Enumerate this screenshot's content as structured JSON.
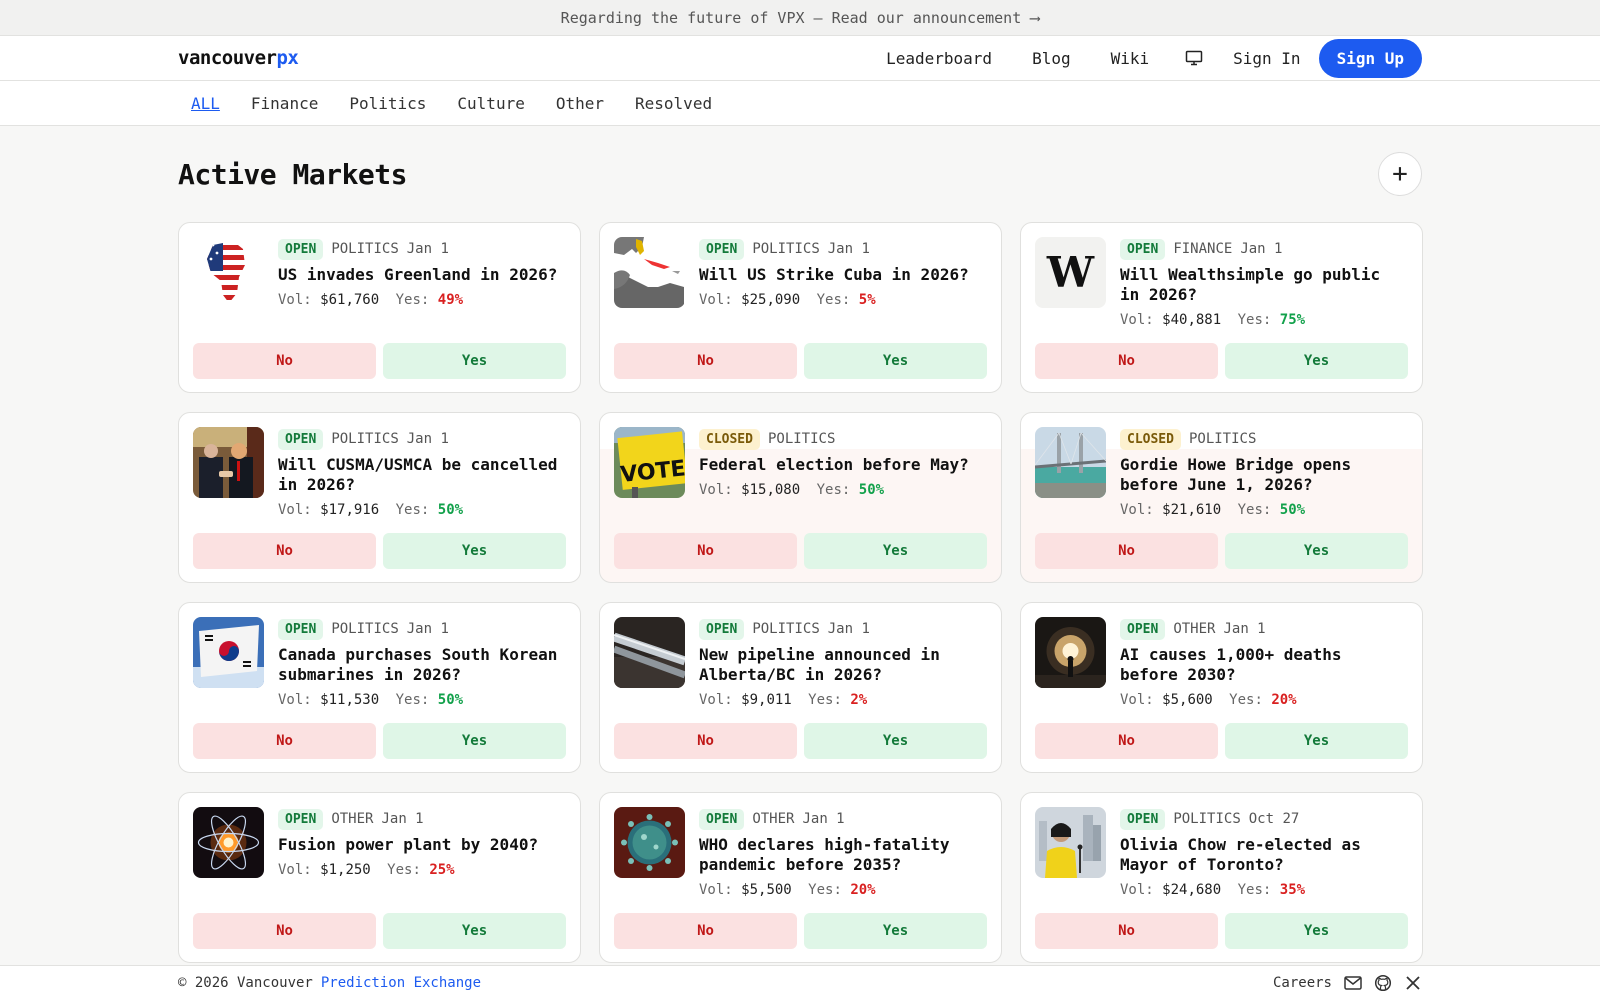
{
  "announcement": "Regarding the future of VPX — Read our announcement ⟶",
  "brand": {
    "name_part1": "vancouver",
    "name_part2": "px",
    "accent": "#1d5bf0"
  },
  "nav": {
    "leaderboard": "Leaderboard",
    "blog": "Blog",
    "wiki": "Wiki",
    "sign_in": "Sign In",
    "sign_up": "Sign Up",
    "display_icon": "monitor-icon"
  },
  "categories": [
    "ALL",
    "Finance",
    "Politics",
    "Culture",
    "Other",
    "Resolved"
  ],
  "active_category": "ALL",
  "page_title": "Active Markets",
  "add_button_glyph": "+",
  "vol_label": "Vol:",
  "yes_label": "Yes:",
  "button_no": "No",
  "button_yes": "Yes",
  "markets": [
    {
      "status": "OPEN",
      "category": "POLITICS",
      "date": "Jan 1",
      "question": "US invades Greenland in 2026?",
      "volume": "$61,760",
      "yes_pct": "49%",
      "pct_color": "red",
      "thumb": "greenland-flag-map"
    },
    {
      "status": "OPEN",
      "category": "POLITICS",
      "date": "Jan 1",
      "question": "Will US Strike Cuba in 2026?",
      "volume": "$25,090",
      "yes_pct": "5%",
      "pct_color": "red",
      "thumb": "cuba-map"
    },
    {
      "status": "OPEN",
      "category": "FINANCE",
      "date": "Jan 1",
      "question": "Will Wealthsimple go public in 2026?",
      "volume": "$40,881",
      "yes_pct": "75%",
      "pct_color": "green",
      "thumb": "wealthsimple-logo"
    },
    {
      "status": "OPEN",
      "category": "POLITICS",
      "date": "Jan 1",
      "question": "Will CUSMA/USMCA be cancelled in 2026?",
      "volume": "$17,916",
      "yes_pct": "50%",
      "pct_color": "green",
      "thumb": "leaders-photo"
    },
    {
      "status": "CLOSED",
      "category": "POLITICS",
      "date": "",
      "question": "Federal election before May?",
      "volume": "$15,080",
      "yes_pct": "50%",
      "pct_color": "green",
      "thumb": "vote-sign"
    },
    {
      "status": "CLOSED",
      "category": "POLITICS",
      "date": "",
      "question": "Gordie Howe Bridge opens before June 1, 2026?",
      "volume": "$21,610",
      "yes_pct": "50%",
      "pct_color": "green",
      "thumb": "bridge-photo"
    },
    {
      "status": "OPEN",
      "category": "POLITICS",
      "date": "Jan 1",
      "question": "Canada purchases South Korean submarines in 2026?",
      "volume": "$11,530",
      "yes_pct": "50%",
      "pct_color": "green",
      "thumb": "korea-flag"
    },
    {
      "status": "OPEN",
      "category": "POLITICS",
      "date": "Jan 1",
      "question": "New pipeline announced in Alberta/BC in 2026?",
      "volume": "$9,011",
      "yes_pct": "2%",
      "pct_color": "red",
      "thumb": "pipeline-photo"
    },
    {
      "status": "OPEN",
      "category": "OTHER",
      "date": "Jan 1",
      "question": "AI causes 1,000+ deaths before 2030?",
      "volume": "$5,600",
      "yes_pct": "20%",
      "pct_color": "red",
      "thumb": "portal-photo"
    },
    {
      "status": "OPEN",
      "category": "OTHER",
      "date": "Jan 1",
      "question": "Fusion power plant by 2040?",
      "volume": "$1,250",
      "yes_pct": "25%",
      "pct_color": "red",
      "thumb": "atom-photo"
    },
    {
      "status": "OPEN",
      "category": "OTHER",
      "date": "Jan 1",
      "question": "WHO declares high-fatality pandemic before 2035?",
      "volume": "$5,500",
      "yes_pct": "20%",
      "pct_color": "red",
      "thumb": "virus-photo"
    },
    {
      "status": "OPEN",
      "category": "POLITICS",
      "date": "Oct 27",
      "question": "Olivia Chow re-elected as Mayor of Toronto?",
      "volume": "$24,680",
      "yes_pct": "35%",
      "pct_color": "red",
      "thumb": "mayor-photo"
    }
  ],
  "footer": {
    "copyright": "© 2026 Vancouver",
    "exchange_link": "Prediction Exchange",
    "careers": "Careers",
    "icons": [
      "mail-icon",
      "github-icon",
      "x-icon"
    ]
  }
}
